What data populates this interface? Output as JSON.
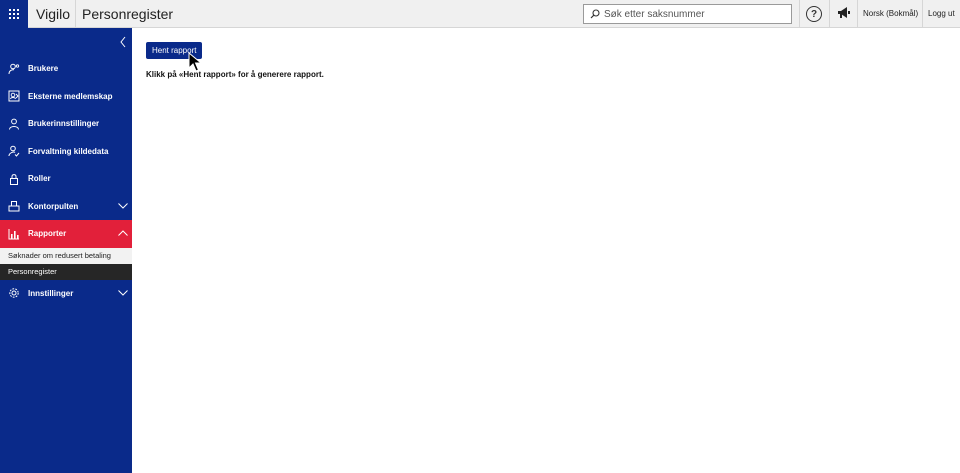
{
  "header": {
    "app_name": "Vigilo",
    "page_title": "Personregister",
    "search_placeholder": "Søk etter saksnummer",
    "language": "Norsk (Bokmål)",
    "logout": "Logg ut"
  },
  "sidebar": {
    "items": [
      {
        "label": "Brukere",
        "icon": "person-key-icon"
      },
      {
        "label": "Eksterne medlemskap",
        "icon": "external-membership-icon"
      },
      {
        "label": "Brukerinnstillinger",
        "icon": "user-icon"
      },
      {
        "label": "Forvaltning kildedata",
        "icon": "user-check-icon"
      },
      {
        "label": "Roller",
        "icon": "lock-icon"
      },
      {
        "label": "Kontorpulten",
        "icon": "desk-icon"
      },
      {
        "label": "Rapporter",
        "icon": "bar-chart-icon"
      },
      {
        "label": "Innstillinger",
        "icon": "gear-icon"
      }
    ],
    "subitems": [
      {
        "label": "Søknader om redusert betaling"
      },
      {
        "label": "Personregister"
      }
    ]
  },
  "main": {
    "button_label": "Hent rapport",
    "hint": "Klikk på «Hent rapport» for å generere rapport."
  },
  "colors": {
    "sidebar_bg": "#0a2a8a",
    "active_item": "#e2203a",
    "selected_sub": "#262626"
  }
}
